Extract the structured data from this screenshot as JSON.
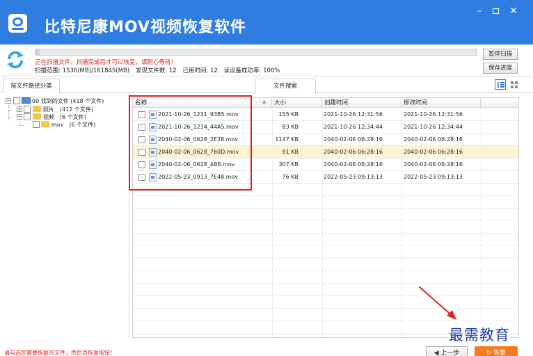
{
  "app": {
    "title": "比特尼康MOV视频恢复软件",
    "window_controls": {
      "minimize": "–",
      "close": "✕"
    },
    "accent_color": "#2f7de1"
  },
  "scan": {
    "warning": "正在扫描文件，扫描完成后才可以恢复，请耐心等待！",
    "range_label": "扫描范围: 1536(MB)/161845(MB)",
    "found_label": "发现文件数: 12",
    "time_label": "已用时间: 12",
    "rate_label": "读设备成功率: 100%",
    "progress_percent": 1,
    "pause_button": "暂停扫描",
    "save_button": "保存进度"
  },
  "tabs": {
    "path_tab": "按文件路径分类",
    "search_tab": "文件搜索"
  },
  "tree": {
    "root": "00 找到的文件 (418 个文件)",
    "photos": "照片　(412 个文件)",
    "videos": "视频　(6 个文件)",
    "mov": "mov　(6 个文件)"
  },
  "list": {
    "headers": {
      "name": "名称",
      "size": "大小",
      "created": "创建时间",
      "modified": "修改时间"
    },
    "rows": [
      {
        "name": "2021-10-26_1231_93B5.mov",
        "size": "155 KB",
        "created": "2021-10-26 12:31:56",
        "modified": "2021-10-26 12:31:56"
      },
      {
        "name": "2021-10-26_1234_44A5.mov",
        "size": "83 KB",
        "created": "2021-10-26 12:34:44",
        "modified": "2021-10-26 12:34:44"
      },
      {
        "name": "2040-02-06_0628_2E38.mov",
        "size": "1147 KB",
        "created": "2040-02-06 06:28:16",
        "modified": "2040-02-06 06:28:16"
      },
      {
        "name": "2040-02-06_0628_760D.mov",
        "size": "91 KB",
        "created": "2040-02-06 06:28:16",
        "modified": "2040-02-06 06:28:16"
      },
      {
        "name": "2040-02-06_0628_A88.mov",
        "size": "307 KB",
        "created": "2040-02-06 06:28:16",
        "modified": "2040-02-06 06:28:16"
      },
      {
        "name": "2022-05-23_0913_7E48.mov",
        "size": "76 KB",
        "created": "2022-05-23 09:13:13",
        "modified": "2022-05-23 09:13:13"
      }
    ],
    "selected_index": 3
  },
  "footer": {
    "note": "请勾选您需要恢复的文件，然后点恢复按钮！",
    "prev_button": "上一步",
    "recover_button": "恢复"
  },
  "watermark": "最需教育"
}
